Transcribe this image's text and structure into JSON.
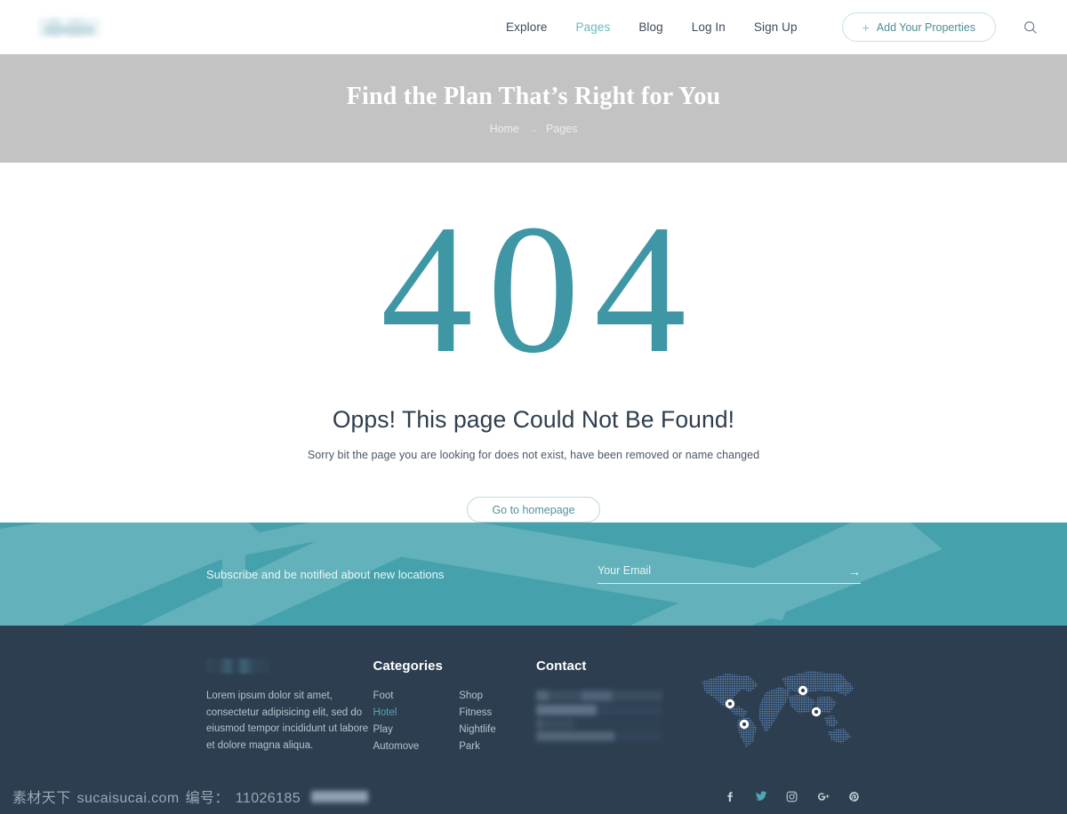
{
  "header": {
    "logo_alt": "site-logo",
    "nav": [
      {
        "label": "Explore",
        "active": false
      },
      {
        "label": "Pages",
        "active": true
      },
      {
        "label": "Blog",
        "active": false
      },
      {
        "label": "Log In",
        "active": false
      },
      {
        "label": "Sign Up",
        "active": false
      }
    ],
    "add_properties": {
      "label": "Add Your Properties",
      "plus": "+"
    },
    "search_icon": "search-icon"
  },
  "hero": {
    "title": "Find the Plan That’s Right for You",
    "breadcrumb": {
      "home": "Home",
      "separator": "→",
      "current": "Pages"
    },
    "bg_color": "#c3c3c3"
  },
  "error": {
    "code": "404",
    "heading": "Opps! This page Could Not Be Found!",
    "description": "Sorry bit the page you are looking for does not exist, have been removed or name changed",
    "button_label": "Go to homepage",
    "code_color": "#3f97a5"
  },
  "newsletter": {
    "text": "Subscribe and be notified about new locations",
    "email_placeholder": "Your Email",
    "email_value": "",
    "submit_icon": "→",
    "bg_color": "#45a2ad"
  },
  "footer": {
    "about": {
      "logo_alt": "footer-logo",
      "text": "Lorem ipsum dolor sit amet, consectetur adipisicing elit, sed do eiusmod tempor incididunt ut labore et dolore magna aliqua."
    },
    "categories": {
      "heading": "Categories",
      "items": [
        {
          "label": "Foot",
          "active": false
        },
        {
          "label": "Shop",
          "active": false
        },
        {
          "label": "Hotel",
          "active": true
        },
        {
          "label": "Fitness",
          "active": false
        },
        {
          "label": "Play",
          "active": false
        },
        {
          "label": "Nightlife",
          "active": false
        },
        {
          "label": "Automove",
          "active": false
        },
        {
          "label": "Park",
          "active": false
        }
      ]
    },
    "contact": {
      "heading": "Contact",
      "details_redacted": true
    },
    "map": {
      "alt": "world-map",
      "markers": 4
    },
    "bg_color": "#2d3e50"
  },
  "bottom": {
    "watermark_cn": "素材天下",
    "watermark_site": "sucaisucai.com",
    "watermark_id_label": "编号：",
    "watermark_id": "11026185",
    "socials": [
      {
        "name": "facebook",
        "glyph": "f",
        "active": false
      },
      {
        "name": "twitter",
        "glyph": "",
        "active": true
      },
      {
        "name": "instagram",
        "glyph": "",
        "active": false
      },
      {
        "name": "google-plus",
        "glyph": "g⁺",
        "active": false
      },
      {
        "name": "pinterest",
        "glyph": "℗",
        "active": false
      }
    ]
  }
}
